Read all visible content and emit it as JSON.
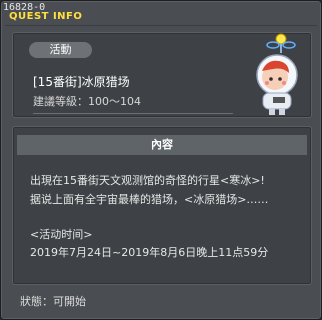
{
  "window": {
    "id": "16828-0",
    "title": "QUEST INFO"
  },
  "event": {
    "tag": "活動",
    "name": "[15番街]冰原猎场",
    "level": "建議等級：100～104"
  },
  "content": {
    "header": "內容",
    "line1": "出現在15番街天文观测馆的奇怪的行星<寒冰>!",
    "line2": "据说上面有全宇宙最棒的猎场，<冰原猎场>……",
    "time_label": "<活动时间>",
    "time_value": "2019年7月24日~2019年8月6日晚上11点59分"
  },
  "status": {
    "text": "狀態：可開始"
  }
}
